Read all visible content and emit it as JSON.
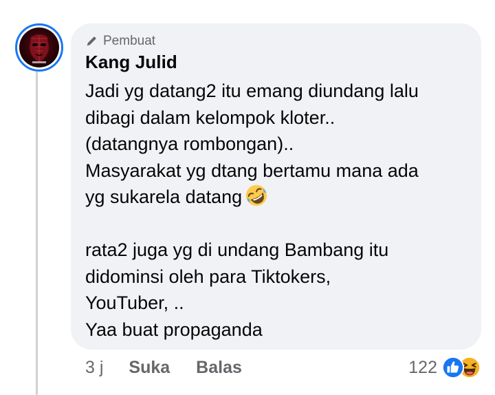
{
  "comment": {
    "role_badge": "Pembuat",
    "author": "Kang Julid",
    "lines": [
      "Jadi yg datang2 itu emang diundang lalu",
      "dibagi dalam kelompok kloter..",
      "(datangnya rombongan)..",
      "Masyarakat yg dtang bertamu mana ada",
      "yg sukarela datang",
      "",
      "rata2 juga yg di undang Bambang itu",
      "didominsi oleh para Tiktokers,",
      "YouTuber, ..",
      "Yaa buat propaganda"
    ],
    "emoji": "rolling-on-floor-laughing"
  },
  "actions": {
    "time": "3 j",
    "like_label": "Suka",
    "reply_label": "Balas"
  },
  "reactions": {
    "count": "122",
    "types": [
      "like",
      "haha"
    ]
  },
  "colors": {
    "bubble": "#f0f2f5",
    "accent": "#1877f2",
    "secondary_text": "#65676b",
    "haha": "#f7b125"
  }
}
